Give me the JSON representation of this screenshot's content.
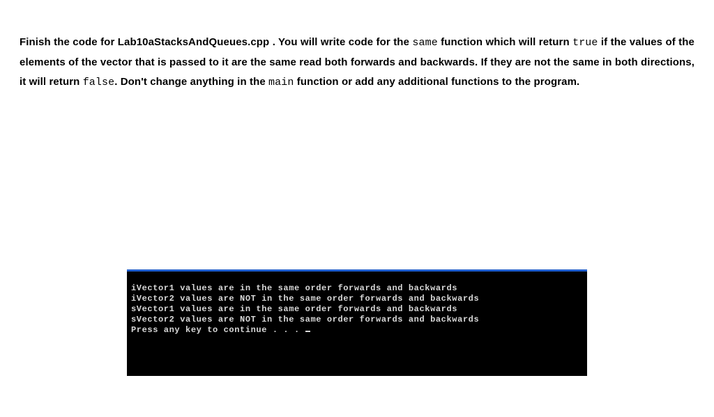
{
  "instruction": {
    "seg1": "Finish the code for Lab10aStacksAndQueues.cpp . You will write code for the ",
    "seg2_mono": "same",
    "seg3": " function which will return ",
    "seg4_mono": "true",
    "seg5": " if the values of the elements of the vector that is passed to it are the same read both forwards and backwards.  If they are not the same in both directions, it will return ",
    "seg6_mono": "false",
    "seg7": ".  Don't change anything in the ",
    "seg8_mono": "main",
    "seg9": " function or add any additional functions to the program."
  },
  "console": {
    "lines": [
      "iVector1 values are in the same order forwards and backwards",
      "iVector2 values are NOT in the same order forwards and backwards",
      "sVector1 values are in the same order forwards and backwards",
      "sVector2 values are NOT in the same order forwards and backwards",
      "Press any key to continue . . . "
    ]
  }
}
